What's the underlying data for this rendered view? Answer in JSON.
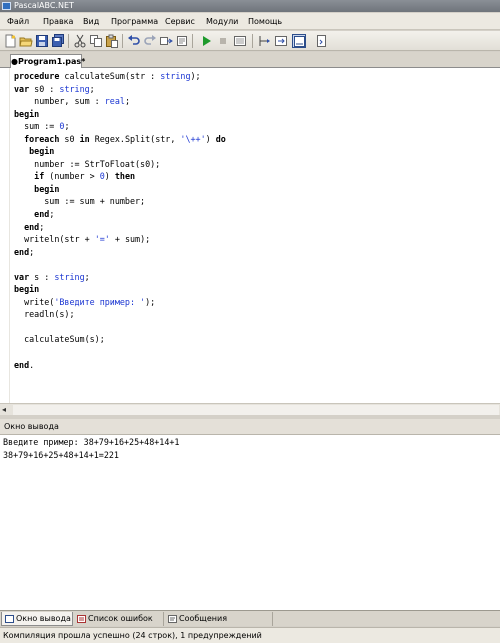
{
  "window": {
    "title": "PascalABC.NET"
  },
  "menubar": {
    "items": [
      {
        "label": "Файл"
      },
      {
        "label": "Правка"
      },
      {
        "label": "Вид"
      },
      {
        "label": "Программа"
      },
      {
        "label": "Сервис"
      },
      {
        "label": "Модули"
      },
      {
        "label": "Помощь"
      }
    ]
  },
  "toolbar": {
    "buttons": [
      "new-file-icon",
      "open-folder-icon",
      "save-icon",
      "save-all-icon",
      "cut-icon",
      "copy-icon",
      "paste-icon",
      "undo-icon",
      "redo-icon",
      "compile-icon",
      "run-icon",
      "stop-icon",
      "debug-window-icon",
      "step-icon",
      "toggle-panel-icon",
      "output-window-icon",
      "help-icon"
    ]
  },
  "editor": {
    "tab_label": "●Program1.pas*",
    "code_lines": [
      "procedure calculateSum(str : string);",
      "var s0 : string;",
      "    number, sum : real;",
      "begin",
      "  sum := 0;",
      "  foreach s0 in Regex.Split(str, '\\++') do",
      "   begin",
      "    number := StrToFloat(s0);",
      "    if (number > 0) then",
      "    begin",
      "      sum := sum + number;",
      "    end;",
      "  end;",
      "  writeln(str + '=' + sum);",
      "end;",
      "",
      "var s : string;",
      "begin",
      "  write('Введите пример: ');",
      "  readln(s);",
      "",
      "  calculateSum(s);",
      "",
      "end."
    ]
  },
  "output": {
    "header": "Окно вывода",
    "lines": [
      "Введите пример: 38+79+16+25+48+14+1",
      "38+79+16+25+48+14+1=221"
    ]
  },
  "bottom_tabs": [
    {
      "label": "Окно вывода",
      "icon": "output-window-icon"
    },
    {
      "label": "Список ошибок",
      "icon": "error-list-icon"
    },
    {
      "label": "Сообщения компилятора",
      "icon": "compiler-messages-icon"
    }
  ],
  "status": {
    "text": "Компиляция прошла успешно (24 строк), 1 предупреждений"
  },
  "colors": {
    "keyword": "#000000",
    "type": "#1b36d2",
    "string": "#1b36d2"
  }
}
